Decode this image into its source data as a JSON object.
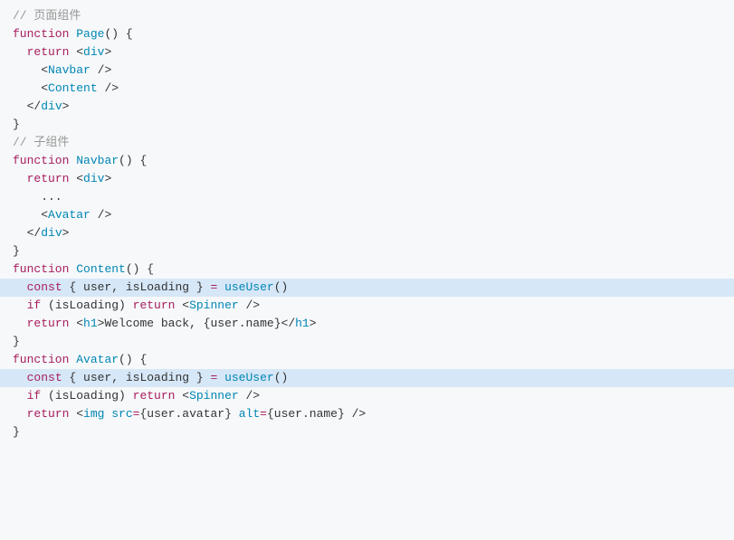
{
  "code": {
    "comment1": "// 页面组件",
    "blank": "",
    "l1": {
      "fn": "function",
      "name": "Page",
      "rest": "() {"
    },
    "l2": {
      "ret": "return",
      "open": " <",
      "tag": "div",
      "close": ">"
    },
    "l3": {
      "open": "<",
      "tag": "Navbar",
      "close": " />"
    },
    "l4": {
      "open": "<",
      "tag": "Content",
      "close": " />"
    },
    "l5": {
      "open": "</",
      "tag": "div",
      "close": ">"
    },
    "l6": "}",
    "comment2": "// 子组件",
    "nav1": {
      "fn": "function",
      "name": "Navbar",
      "rest": "() {"
    },
    "nav2": {
      "ret": "return",
      "open": " <",
      "tag": "div",
      "close": ">"
    },
    "nav3": "    ...",
    "nav4": {
      "open": "<",
      "tag": "Avatar",
      "close": " />"
    },
    "nav5": {
      "open": "</",
      "tag": "div",
      "close": ">"
    },
    "nav6": "}",
    "con1": {
      "fn": "function",
      "name": "Content",
      "rest": "() {"
    },
    "con2": {
      "const": "const",
      "destruct": " { user, isLoading } ",
      "eq": "=",
      "sp": " ",
      "call": "useUser",
      "paren": "()"
    },
    "con3": {
      "if": "if",
      "cond": " (isLoading) ",
      "ret": "return",
      "open": " <",
      "tag": "Spinner",
      "close": " />"
    },
    "con4": {
      "ret": "return",
      "open": " <",
      "tag": "h1",
      "gt": ">",
      "text1": "Welcome back, ",
      "lbrace": "{",
      "expr": "user.name",
      "rbrace": "}",
      "close1": "</",
      "tag2": "h1",
      "close2": ">"
    },
    "con5": "}",
    "av1": {
      "fn": "function",
      "name": "Avatar",
      "rest": "() {"
    },
    "av2": {
      "const": "const",
      "destruct": " { user, isLoading } ",
      "eq": "=",
      "sp": " ",
      "call": "useUser",
      "paren": "()"
    },
    "av3": {
      "if": "if",
      "cond": " (isLoading) ",
      "ret": "return",
      "open": " <",
      "tag": "Spinner",
      "close": " />"
    },
    "av4": {
      "ret": "return",
      "open": " <",
      "tag": "img",
      "sp1": " ",
      "attr1": "src",
      "eq1": "=",
      "lb1": "{",
      "val1": "user.avatar",
      "rb1": "}",
      "sp2": " ",
      "attr2": "alt",
      "eq2": "=",
      "lb2": "{",
      "val2": "user.name",
      "rb2": "}",
      "close": " />"
    },
    "av5": "}"
  }
}
